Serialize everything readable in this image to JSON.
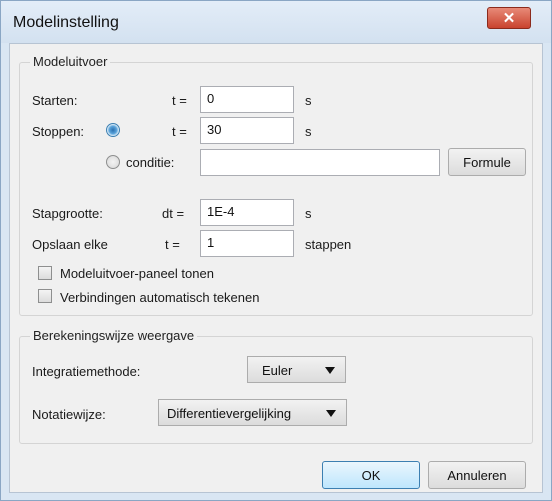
{
  "window": {
    "title": "Modelinstelling",
    "close_symbol": "✕"
  },
  "model_output": {
    "legend": "Modeluitvoer",
    "start": {
      "label": "Starten:",
      "var": "t =",
      "value": "0",
      "unit": "s"
    },
    "stop": {
      "label": "Stoppen:",
      "var": "t =",
      "value": "30",
      "unit": "s",
      "selected": true
    },
    "condition": {
      "label": "conditie:",
      "value": "",
      "selected": false,
      "button": "Formule"
    },
    "step": {
      "label": "Stapgrootte:",
      "var": "dt =",
      "value": "1E-4",
      "unit": "s"
    },
    "save": {
      "label": "Opslaan elke",
      "var": "t =",
      "value": "1",
      "unit": "stappen"
    },
    "checkboxes": [
      {
        "label": "Modeluitvoer-paneel tonen",
        "checked": false
      },
      {
        "label": "Verbindingen automatisch tekenen",
        "checked": false
      }
    ]
  },
  "calc_display": {
    "legend": "Berekeningswijze weergave",
    "integration": {
      "label": "Integratiemethode:",
      "value": "Euler"
    },
    "notation": {
      "label": "Notatiewijze:",
      "value": "Differentievergelijking"
    }
  },
  "buttons": {
    "ok": "OK",
    "cancel": "Annuleren"
  },
  "icons": {
    "close": "close-icon",
    "dropdown": "chevron-down-icon"
  },
  "colors": {
    "title_bar": "#d9e6f3",
    "close_button": "#c9432e",
    "radio_selected": "#2a6fb0"
  }
}
